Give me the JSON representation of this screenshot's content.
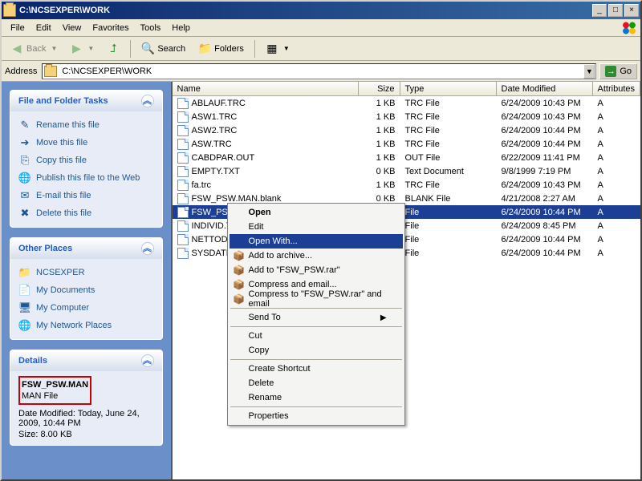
{
  "window": {
    "title": "C:\\NCSEXPER\\WORK",
    "btn_min": "_",
    "btn_max": "□",
    "btn_close": "×"
  },
  "menu": {
    "file": "File",
    "edit": "Edit",
    "view": "View",
    "favorites": "Favorites",
    "tools": "Tools",
    "help": "Help"
  },
  "toolbar": {
    "back": "Back",
    "search": "Search",
    "folders": "Folders"
  },
  "address": {
    "label": "Address",
    "value": "C:\\NCSEXPER\\WORK",
    "go": "Go"
  },
  "columns": {
    "name": "Name",
    "size": "Size",
    "type": "Type",
    "date": "Date Modified",
    "attr": "Attributes"
  },
  "files": [
    {
      "name": "ABLAUF.TRC",
      "size": "1 KB",
      "type": "TRC File",
      "date": "6/24/2009 10:43 PM",
      "attr": "A",
      "sel": false
    },
    {
      "name": "ASW1.TRC",
      "size": "1 KB",
      "type": "TRC File",
      "date": "6/24/2009 10:43 PM",
      "attr": "A",
      "sel": false
    },
    {
      "name": "ASW2.TRC",
      "size": "1 KB",
      "type": "TRC File",
      "date": "6/24/2009 10:44 PM",
      "attr": "A",
      "sel": false
    },
    {
      "name": "ASW.TRC",
      "size": "1 KB",
      "type": "TRC File",
      "date": "6/24/2009 10:44 PM",
      "attr": "A",
      "sel": false
    },
    {
      "name": "CABDPAR.OUT",
      "size": "1 KB",
      "type": "OUT File",
      "date": "6/22/2009 11:41 PM",
      "attr": "A",
      "sel": false
    },
    {
      "name": "EMPTY.TXT",
      "size": "0 KB",
      "type": "Text Document",
      "date": "9/8/1999 7:19 PM",
      "attr": "A",
      "sel": false
    },
    {
      "name": "fa.trc",
      "size": "1 KB",
      "type": "TRC File",
      "date": "6/24/2009 10:43 PM",
      "attr": "A",
      "sel": false
    },
    {
      "name": "FSW_PSW.MAN.blank",
      "size": "0 KB",
      "type": "BLANK File",
      "date": "4/21/2008 2:27 AM",
      "attr": "A",
      "sel": false
    },
    {
      "name": "FSW_PSW.MAN",
      "size": "",
      "type": "File",
      "date": "6/24/2009 10:44 PM",
      "attr": "A",
      "sel": true
    },
    {
      "name": "INDIVID.TR",
      "size": "",
      "type": "File",
      "date": "6/24/2009 8:45 PM",
      "attr": "A",
      "sel": false
    },
    {
      "name": "NETTODAT",
      "size": "",
      "type": "File",
      "date": "6/24/2009 10:44 PM",
      "attr": "A",
      "sel": false
    },
    {
      "name": "SYSDATEN",
      "size": "",
      "type": "File",
      "date": "6/24/2009 10:44 PM",
      "attr": "A",
      "sel": false
    }
  ],
  "sidebar": {
    "tasks_hd": "File and Folder Tasks",
    "tasks": [
      {
        "ic": "✎",
        "label": "Rename this file"
      },
      {
        "ic": "➔",
        "label": "Move this file"
      },
      {
        "ic": "⎘",
        "label": "Copy this file"
      },
      {
        "ic": "🌐",
        "label": "Publish this file to the Web"
      },
      {
        "ic": "✉",
        "label": "E-mail this file"
      },
      {
        "ic": "✖",
        "label": "Delete this file"
      }
    ],
    "places_hd": "Other Places",
    "places": [
      {
        "ic": "📁",
        "label": "NCSEXPER"
      },
      {
        "ic": "📄",
        "label": "My Documents"
      },
      {
        "ic": "🖥",
        "label": "My Computer"
      },
      {
        "ic": "🌐",
        "label": "My Network Places"
      }
    ],
    "details_hd": "Details",
    "details": {
      "name": "FSW_PSW.MAN",
      "type": "MAN File",
      "modified_label": "Date Modified: Today, June 24, 2009, 10:44 PM",
      "size_label": "Size: 8.00 KB"
    }
  },
  "ctx": {
    "open": "Open",
    "edit": "Edit",
    "openwith": "Open With...",
    "addarch": "Add to archive...",
    "addrar": "Add to \"FSW_PSW.rar\"",
    "comp": "Compress and email...",
    "comprar": "Compress to \"FSW_PSW.rar\" and email",
    "sendto": "Send To",
    "cut": "Cut",
    "copy": "Copy",
    "shortcut": "Create Shortcut",
    "delete": "Delete",
    "rename": "Rename",
    "properties": "Properties"
  }
}
